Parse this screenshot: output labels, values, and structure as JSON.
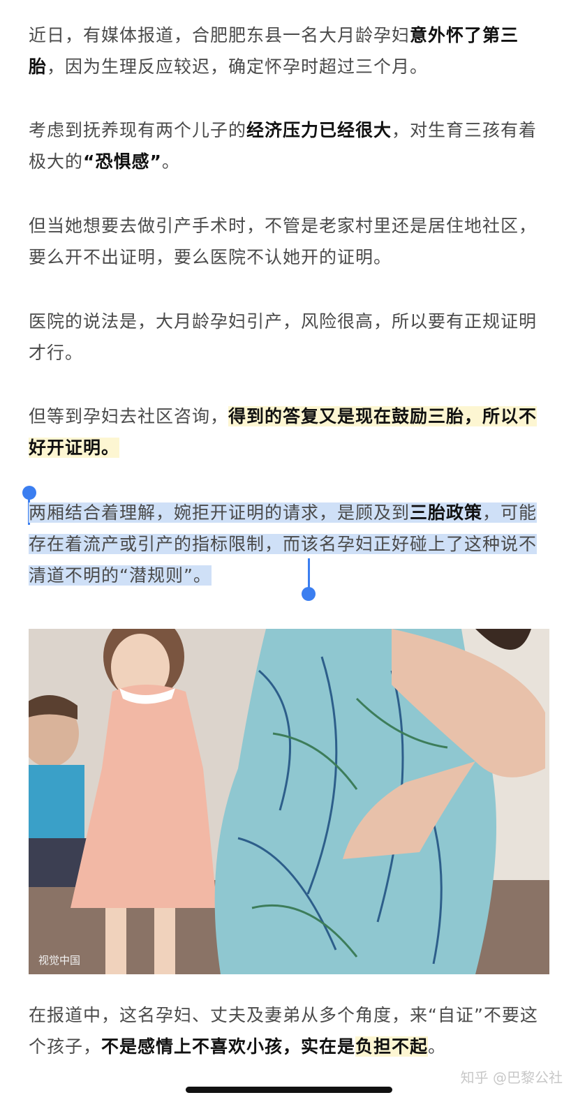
{
  "paragraphs": [
    {
      "a": "近日，有媒体报道，合肥肥东县一名大月龄孕妇",
      "b": "意外怀了第三胎",
      "c": "，因为生理反应较迟，确定怀孕时超过三个月。"
    },
    {
      "a": "考虑到抚养现有两个儿子的",
      "b": "经济压力已经很大",
      "c": "，对生育三孩有着极大的",
      "d": "“恐惧感”",
      "e": "。"
    },
    {
      "text": "但当她想要去做引产手术时，不管是老家村里还是居住地社区，要么开不出证明，要么医院不认她开的证明。"
    },
    {
      "text": "医院的说法是，大月龄孕妇引产，风险很高，所以要有正规证明才行。"
    },
    {
      "a": "但等到孕妇去社区咨询，",
      "b": "得到的答复又是现在鼓励三胎，所以不好开证明。"
    },
    {
      "a": "两厢结合着理解，婉拒开证明的请求，是顾及到",
      "b": "三胎政策",
      "c": "，可能存在着流产或引产的指标限制，而该名孕妇正好碰上了这种说不清道不明的“潜规则”。"
    },
    {
      "a": "在报道中，这名孕妇、丈夫及妻弟从多个角度，来“自证”不要这个孩子，",
      "b": "不是感情上不喜欢小孩，实在是",
      "c": "负担不起",
      "d": "。"
    }
  ],
  "image": {
    "credit": "视觉中国"
  },
  "watermark": "知乎 @巴黎公社",
  "colors": {
    "selection": "#cfe0f7",
    "highlight": "#fdf6d2",
    "handle": "#3b7ef0"
  }
}
